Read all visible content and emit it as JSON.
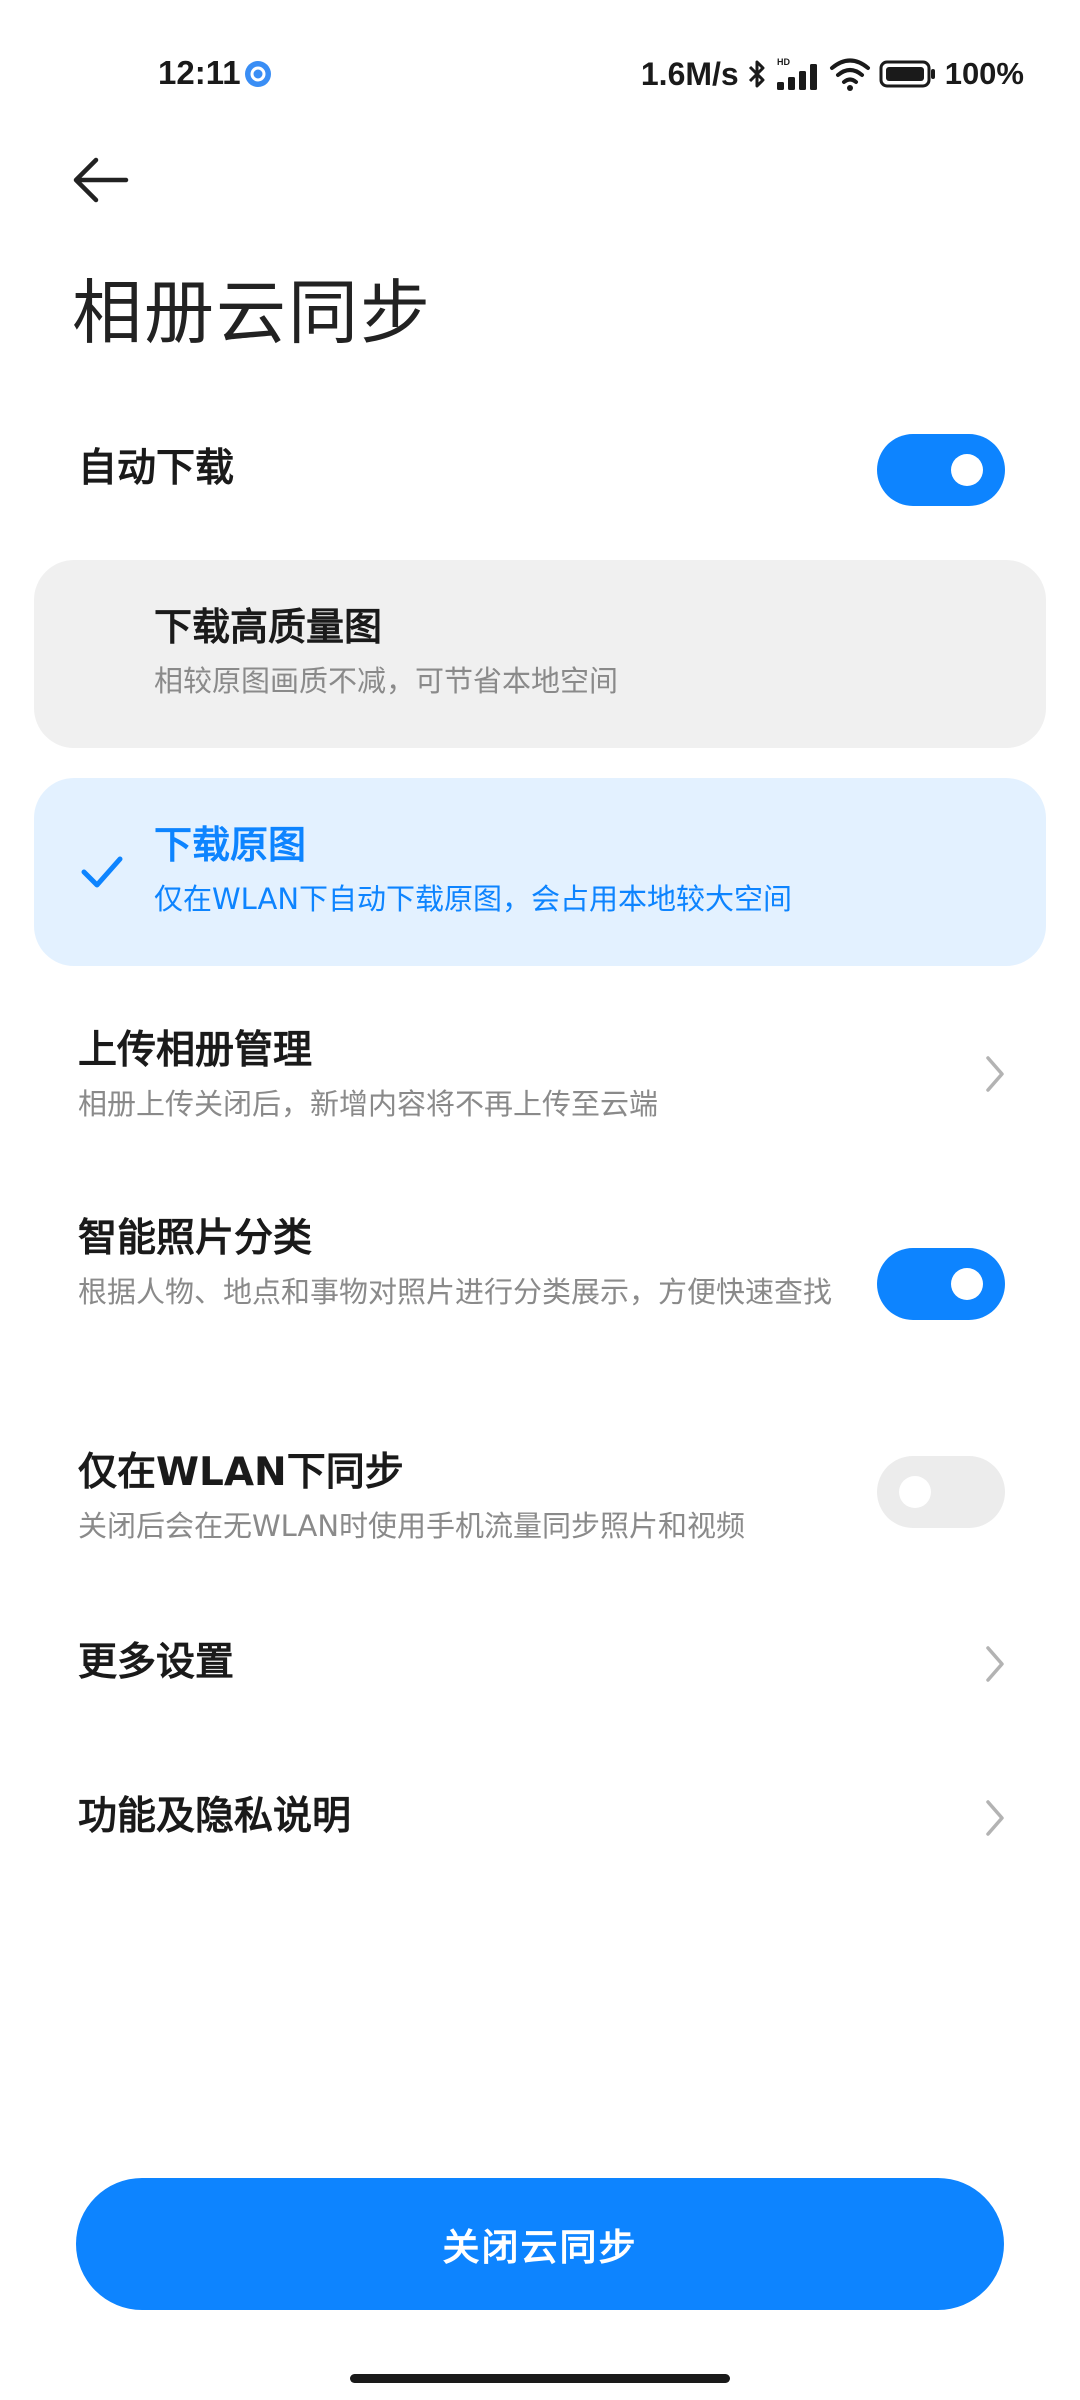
{
  "status_bar": {
    "time": "12:11",
    "network_speed": "1.6M/s",
    "network_badge": "HD",
    "battery": "100%",
    "icons": [
      "app-notification-icon",
      "bluetooth-icon",
      "signal-icon",
      "wifi-icon",
      "battery-icon"
    ]
  },
  "header": {
    "back_icon": "arrow-left-icon",
    "title": "相册云同步"
  },
  "auto_download": {
    "label": "自动下载",
    "enabled": true
  },
  "download_options": [
    {
      "title": "下载高质量图",
      "description": "相较原图画质不减，可节省本地空间",
      "selected": false
    },
    {
      "title": "下载原图",
      "description": "仅在WLAN下自动下载原图，会占用本地较大空间",
      "selected": true,
      "icon": "checkmark-icon"
    }
  ],
  "settings": {
    "upload_management": {
      "title": "上传相册管理",
      "description": "相册上传关闭后，新增内容将不再上传至云端"
    },
    "smart_classification": {
      "title": "智能照片分类",
      "description": "根据人物、地点和事物对照片进行分类展示，方便快速查找",
      "enabled": true
    },
    "wlan_only": {
      "title": "仅在WLAN下同步",
      "description": "关闭后会在无WLAN时使用手机流量同步照片和视频",
      "enabled": false
    },
    "more_settings": {
      "title": "更多设置"
    },
    "privacy": {
      "title": "功能及隐私说明"
    }
  },
  "footer": {
    "button_label": "关闭云同步"
  },
  "colors": {
    "accent": "#0d84ff",
    "selected_card_bg": "#e3f1ff",
    "unselected_card_bg": "#f0f0f0",
    "toggle_off": "#ececec",
    "secondary_text": "#8a8a8a"
  }
}
